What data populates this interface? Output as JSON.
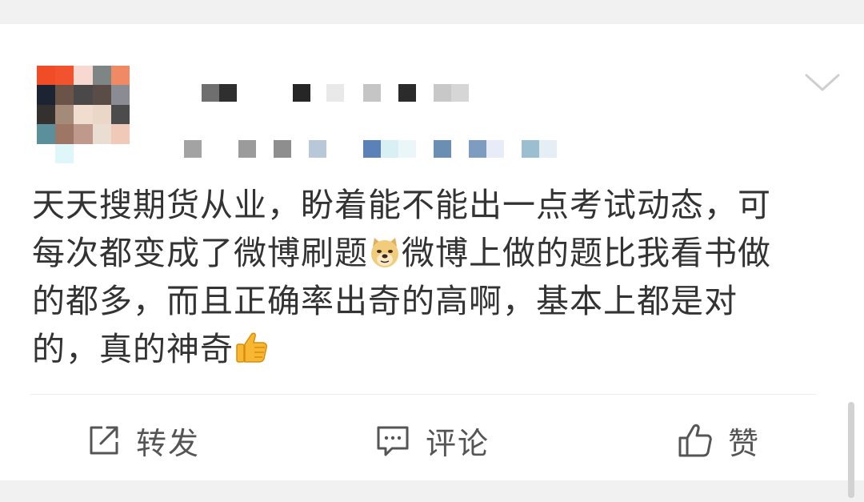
{
  "post": {
    "text_line_1": "天天搜期货从业，盼着能不能出一点考试动态，可",
    "text_line_2a": "每次都变成了微博刷题",
    "text_line_2b": "微博上做的题比我看书做",
    "text_line_3": "的都多，而且正确率出奇的高啊，基本上都是对",
    "text_line_4": "的，真的神奇",
    "emoji_1": "doge-emoji",
    "emoji_2": "thumbs-up-emoji"
  },
  "actions": {
    "repost_label": "转发",
    "comment_label": "评论",
    "like_label": "赞"
  },
  "colors": {
    "page_bg": "#f1f1f1",
    "card_bg": "#ffffff",
    "text": "#333333",
    "icon": "#555555"
  }
}
